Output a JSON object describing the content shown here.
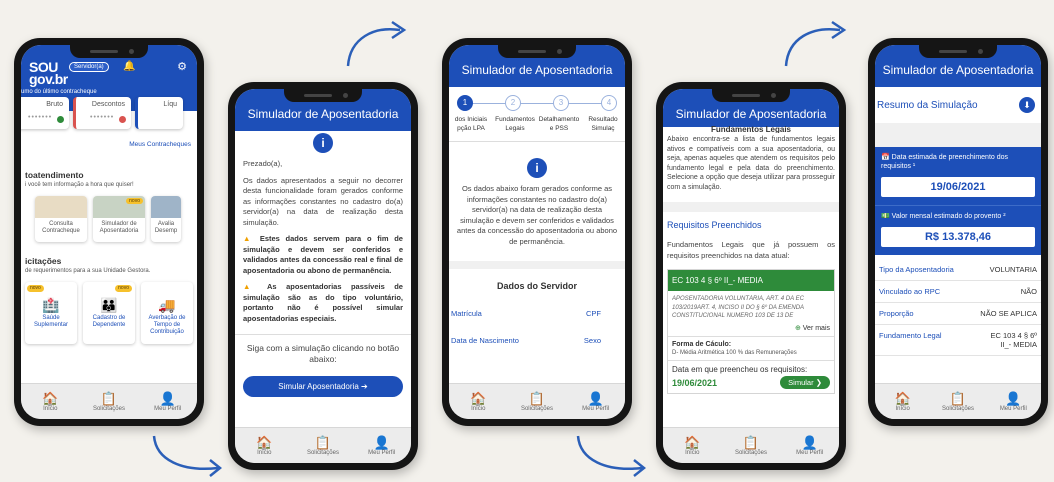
{
  "phones": {
    "p1": {
      "logo": "SOU gov.br",
      "profile_pill": "Servidor(a)",
      "summary_label": "umo do último contracheque",
      "cards": [
        "Bruto",
        "Descontos",
        "Líqu"
      ],
      "link_payslips": "Meus Contracheques",
      "section_self": "toatendimento",
      "section_self_sub": "i você tem informação a hora que quiser!",
      "tiles": [
        {
          "label": "Consulta Contracheque",
          "badge": ""
        },
        {
          "label": "Simulador de Aposentadoria",
          "badge": "novo"
        },
        {
          "label": "Avalia Desemp",
          "badge": ""
        }
      ],
      "section_req": "icitações",
      "section_req_sub": "de requerimentos para a sua Unidade Gestora.",
      "req_tiles": [
        {
          "label": "Saúde Suplementar",
          "badge": "novo"
        },
        {
          "label": "Cadastro de Dependente",
          "badge": "novo"
        },
        {
          "label": "Averbação de Tempo de Contribuição",
          "badge": ""
        }
      ]
    },
    "p2": {
      "title": "Simulador de Aposentadoria",
      "greeting": "Prezado(a),",
      "para1": "Os dados apresentados a seguir no decorrer desta funcionalidade foram gerados conforme as informações constantes no cadastro do(a) servidor(a) na data de realização desta simulação.",
      "para2": "Estes dados servem para o fim de simulação e devem ser conferidos e validados antes da concessão real e final de aposentadoria ou abono de permanência.",
      "para3": "As aposentadorias passíveis de simulação são as do tipo voluntário, portanto não é possível simular aposentadorias especiais.",
      "continue_text": "Siga com a simulação clicando no botão abaixo:",
      "button": "Simular Aposentadoria"
    },
    "p3": {
      "title": "Simulador de Aposentadoria",
      "steps": [
        "1",
        "2",
        "3",
        "4"
      ],
      "step_labels": [
        "dos Iniciais pção LPA",
        "Fundamentos Legais",
        "Detalhamento e PSS",
        "Resultado Simulaç"
      ],
      "info_text": "Os dados abaixo foram gerados conforme as informações constantes no cadastro do(a) servidor(a) na data de realização desta simulação e devem ser conferidos e validados antes da concessão do aposentadoria ou abono de permanência.",
      "section": "Dados do Servidor",
      "fields": [
        "Matrícula",
        "CPF",
        "Data de Nascimento",
        "Sexo"
      ]
    },
    "p4": {
      "title": "Simulador de Aposentadoria",
      "subtitle": "Fundamentos Legais",
      "intro": "Abaixo encontra-se a lista de fundamentos legais ativos e compatíveis com a sua aposentadoria, ou seja, apenas aqueles que atendem os requisitos pelo fundamento legal e pela data do preenchimento. Selecione a opção que deseja utilizar para prosseguir com a simulação.",
      "section": "Requisitos Preenchidos",
      "section_text": "Fundamentos Legais que já possuem os requisitos preenchidos na data atual:",
      "item_title": "EC 103 4 § 6º II_- MEDIA",
      "item_desc": "APOSENTADORIA VOLUNTÁRIA, ART. 4 DA EC 103/2019ART. 4, INCISO II DO § 6º DA EMENDA CONSTITUCIONAL NUMERO 103 DE 13 DE",
      "see_more": "Ver mais",
      "calc_label": "Forma de Cáculo:",
      "calc_value": "D- Média Aritmética 100 % das Remunerações",
      "date_label": "Data em que preencheu os requisitos:",
      "date_value": "19/06/2021",
      "button": "Simular"
    },
    "p5": {
      "title": "Simulador de Aposentadoria",
      "heading": "Resumo da Simulação",
      "date_label": "Data estimada de preenchimento dos requisitos ¹",
      "date_value": "19/06/2021",
      "value_label": "Valor mensal estimado do provento ²",
      "value": "R$ 13.378,46",
      "rows": [
        {
          "k": "Tipo da Aposentadoria",
          "v": "VOLUNTARIA"
        },
        {
          "k": "Vinculado ao RPC",
          "v": "NÃO"
        },
        {
          "k": "Proporção",
          "v": "NÃO SE APLICA"
        },
        {
          "k": "Fundamento Legal",
          "v": "EC 103 4 § 6º II_- MEDIA"
        }
      ]
    }
  },
  "tabbar": {
    "home": "Início",
    "requests": "Solicitações",
    "profile": "Meu Perfil"
  },
  "colors": {
    "primary": "#1d4fb8",
    "success": "#2e8b3a",
    "warning": "#f0a000",
    "accent_orange": "#ff7a00"
  }
}
